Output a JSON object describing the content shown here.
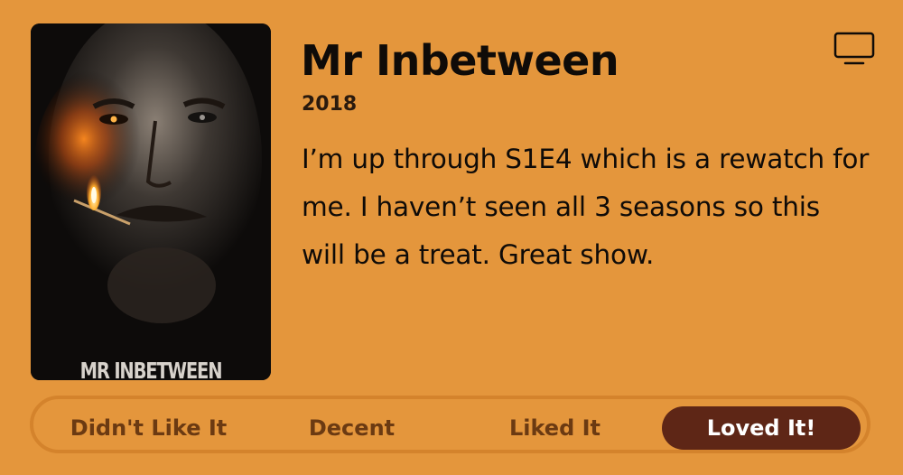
{
  "show": {
    "poster_title": "MR INBETWEEN",
    "title": "Mr Inbetween",
    "year": "2018",
    "review": "I’m up through S1E4 which is a rewatch for me. I haven’t seen all 3 seasons so this will be a treat. Great show."
  },
  "media_type_icon": "tv-icon",
  "rating": {
    "options": [
      {
        "label": "Didn't Like It"
      },
      {
        "label": "Decent"
      },
      {
        "label": "Liked It"
      },
      {
        "label": "Loved It!"
      }
    ],
    "selected": "Loved It!"
  },
  "colors": {
    "background": "#E4963C",
    "selected_pill": "#5E2616",
    "unselected_text": "#6b3a12",
    "bar_border": "#D4832C"
  }
}
